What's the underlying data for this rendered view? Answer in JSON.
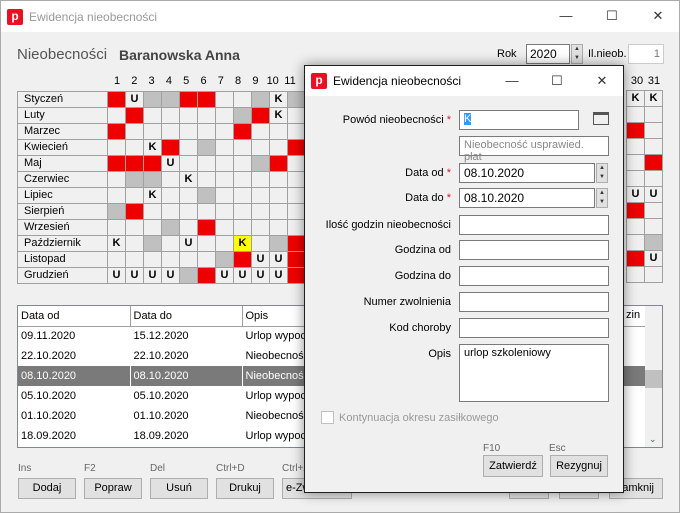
{
  "window": {
    "title": "Ewidencja nieobecności",
    "minimize": "—",
    "maximize": "☐",
    "close": "✕"
  },
  "header": {
    "section": "Nieobecności",
    "employee": "Baranowska Anna",
    "year_label": "Rok",
    "year": "2020",
    "count_label": "Il.nieob.",
    "count": "1"
  },
  "calendar": {
    "days_left": [
      "1",
      "2",
      "3",
      "4",
      "5",
      "6",
      "7",
      "8",
      "9",
      "10",
      "11"
    ],
    "days_right": [
      "30",
      "31"
    ],
    "months": [
      "Styczeń",
      "Luty",
      "Marzec",
      "Kwiecień",
      "Maj",
      "Czerwiec",
      "Lipiec",
      "Sierpień",
      "Wrzesień",
      "Październik",
      "Listopad",
      "Grudzień"
    ]
  },
  "list": {
    "columns": [
      "Data od",
      "Data do",
      "Opis",
      "zin"
    ],
    "rows": [
      [
        "09.11.2020",
        "15.12.2020",
        "Urlop wypoc"
      ],
      [
        "22.10.2020",
        "22.10.2020",
        "Nieobecność"
      ],
      [
        "08.10.2020",
        "08.10.2020",
        "Nieobecność"
      ],
      [
        "05.10.2020",
        "05.10.2020",
        "Urlop wypoc"
      ],
      [
        "01.10.2020",
        "01.10.2020",
        "Nieobecność"
      ],
      [
        "18.09.2020",
        "18.09.2020",
        "Urlop wypoc"
      ]
    ]
  },
  "toolbar": {
    "ins": "Ins",
    "f2": "F2",
    "del": "Del",
    "ctrld": "Ctrl+D",
    "ctrlz": "Ctrl+Z",
    "add": "Dodaj",
    "edit": "Popraw",
    "delete": "Usuń",
    "print": "Drukuj",
    "ezw": "e-Zw",
    "close": "amknij"
  },
  "dialog": {
    "title": "Ewidencja nieobecności",
    "reason_label": "Powód nieobecności",
    "reason_value": "K",
    "reason_desc": "Nieobecność usprawied. płat",
    "from_label": "Data od",
    "from_value": "08.10.2020",
    "to_label": "Data do",
    "to_value": "08.10.2020",
    "hours_label": "Ilość godzin nieobecności",
    "time_from_label": "Godzina od",
    "time_to_label": "Godzina do",
    "sick_no_label": "Numer zwolnienia",
    "disease_label": "Kod choroby",
    "desc_label": "Opis",
    "desc_value": "urlop szkoleniowy",
    "continuation_label": "Kontynuacja okresu zasiłkowego",
    "f10": "F10",
    "esc": "Esc",
    "approve": "Zatwierdź",
    "cancel": "Rezygnuj"
  },
  "colors": {
    "absence": "#ef0000",
    "weekend": "#c0c0c0",
    "highlight": "#ffff00",
    "selection": "#7a7a7a"
  }
}
